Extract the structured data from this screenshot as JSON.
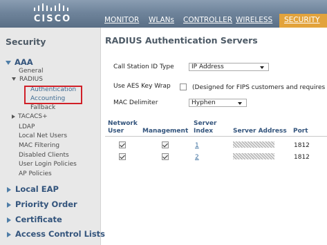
{
  "header": {
    "logo_text": "CISCO",
    "nav": [
      {
        "label": "MONITOR"
      },
      {
        "label": "WLANs"
      },
      {
        "label": "CONTROLLER"
      },
      {
        "label": "WIRELESS"
      },
      {
        "label": "SECURITY",
        "active": true
      }
    ],
    "active_color": "#e2a33c"
  },
  "sidebar": {
    "title": "Security",
    "aaa": {
      "label": "AAA",
      "general": "General",
      "radius": {
        "label": "RADIUS",
        "authentication": "Authentication",
        "accounting": "Accounting",
        "fallback": "Fallback"
      },
      "tacacs": "TACACS+",
      "ldap": "LDAP",
      "local_net_users": "Local Net Users",
      "mac_filtering": "MAC Filtering",
      "disabled_clients": "Disabled Clients",
      "user_login_policies": "User Login Policies",
      "ap_policies": "AP Policies"
    },
    "groups": {
      "local_eap": "Local EAP",
      "priority_order": "Priority Order",
      "certificate": "Certificate",
      "acl": "Access Control Lists"
    },
    "highlight_color": "#d01f27"
  },
  "main": {
    "title": "RADIUS Authentication Servers",
    "form": {
      "call_station_label": "Call Station ID Type",
      "call_station_value": "IP Address",
      "aes_label": "Use AES Key Wrap",
      "aes_checked": false,
      "aes_note": "(Designed for FIPS customers and requires a",
      "mac_delim_label": "MAC Delimiter",
      "mac_delim_value": "Hyphen"
    },
    "table": {
      "headers": {
        "network_user_1": "Network",
        "network_user_2": "User",
        "management": "Management",
        "server_index_1": "Server",
        "server_index_2": "Index",
        "server_address": "Server Address",
        "port": "Port"
      },
      "rows": [
        {
          "network_user": true,
          "management": true,
          "index": "1",
          "port": "1812"
        },
        {
          "network_user": true,
          "management": true,
          "index": "2",
          "port": "1812"
        }
      ]
    }
  }
}
